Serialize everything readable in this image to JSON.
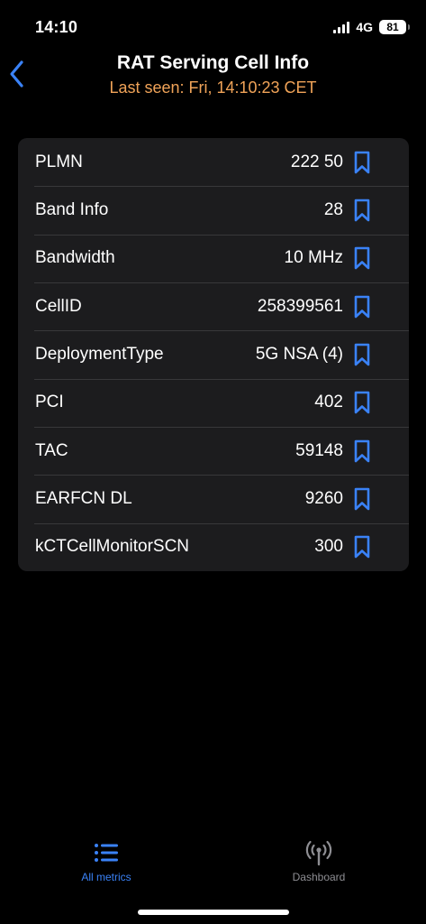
{
  "status_bar": {
    "time": "14:10",
    "network": "4G",
    "battery": "81"
  },
  "header": {
    "title": "RAT Serving Cell Info",
    "subtitle": "Last seen: Fri, 14:10:23 CET"
  },
  "rows": [
    {
      "label": "PLMN",
      "value": "222 50"
    },
    {
      "label": "Band Info",
      "value": "28"
    },
    {
      "label": "Bandwidth",
      "value": "10 MHz"
    },
    {
      "label": "CellID",
      "value": "258399561"
    },
    {
      "label": "DeploymentType",
      "value": "5G NSA (4)"
    },
    {
      "label": "PCI",
      "value": "402"
    },
    {
      "label": "TAC",
      "value": "59148"
    },
    {
      "label": "EARFCN DL",
      "value": "9260"
    },
    {
      "label": "kCTCellMonitorSCN",
      "value": "300"
    }
  ],
  "tabs": {
    "all_metrics": "All metrics",
    "dashboard": "Dashboard"
  },
  "colors": {
    "accent": "#3a82f7",
    "subtitle": "#f0a358",
    "card": "#1c1c1e",
    "inactive_tab": "#8e8e93"
  },
  "icons": {
    "back": "chevron-left-icon",
    "bookmark": "bookmark-icon",
    "all_metrics": "list-icon",
    "dashboard": "antenna-icon"
  }
}
